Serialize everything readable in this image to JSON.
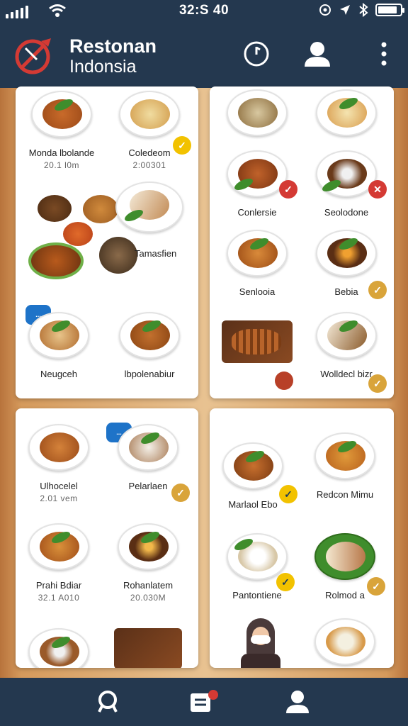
{
  "status_bar": {
    "time": "32:S 40",
    "battery_level_percent": 85
  },
  "app": {
    "title": "Restonan",
    "subtitle": "Indonsia"
  },
  "icons": {
    "logo": "restaurant-logo-icon",
    "history": "clock-icon",
    "profile": "user-icon",
    "menu": "more-vertical-icon",
    "nav_search": "search-icon",
    "nav_orders": "list-icon",
    "nav_account": "user-icon"
  },
  "colors": {
    "bar": "#24384f",
    "badge_red": "#d43a34",
    "badge_gold": "#d9a43a",
    "badge_yellow": "#f2c200",
    "bubble_blue": "#1e73c8"
  },
  "panels": {
    "p1": {
      "dishes": [
        {
          "name": "Monda lbolande",
          "sub": "20.1 l0m"
        },
        {
          "name": "Coledeom",
          "sub": "2:00301"
        },
        {
          "name": "Tamasfien",
          "sub": ""
        },
        {
          "name": "Neugceh",
          "sub": ""
        },
        {
          "name": "lbpolenabiur",
          "sub": ""
        }
      ]
    },
    "p2": {
      "dishes": [
        {
          "name": "",
          "sub": ""
        },
        {
          "name": "",
          "sub": ""
        },
        {
          "name": "Conlersie",
          "sub": ""
        },
        {
          "name": "Seolodone",
          "sub": ""
        },
        {
          "name": "Senlooia",
          "sub": ""
        },
        {
          "name": "Bebia",
          "sub": ""
        },
        {
          "name": "",
          "sub": ""
        },
        {
          "name": "Wolldecl bizr",
          "sub": ""
        }
      ]
    },
    "p3": {
      "dishes": [
        {
          "name": "Ulhocelel",
          "sub": "2.01 vem"
        },
        {
          "name": "Pelarlaen",
          "sub": ""
        },
        {
          "name": "Prahi Bdiar",
          "sub": "32.1 A010"
        },
        {
          "name": "Rohanlatem",
          "sub": "20.030M"
        },
        {
          "name": "",
          "sub": ""
        },
        {
          "name": "",
          "sub": ""
        }
      ]
    },
    "p4": {
      "dishes": [
        {
          "name": "Marlaol Ebo",
          "sub": ""
        },
        {
          "name": "Redcon Mimu",
          "sub": ""
        },
        {
          "name": "Pantontiene",
          "sub": ""
        },
        {
          "name": "Rolmod a",
          "sub": ""
        },
        {
          "name": "",
          "sub": ""
        },
        {
          "name": "",
          "sub": ""
        }
      ]
    }
  },
  "bubble_text": "...",
  "badges": {
    "check": "✓",
    "x": "✕",
    "chev": "✓"
  }
}
